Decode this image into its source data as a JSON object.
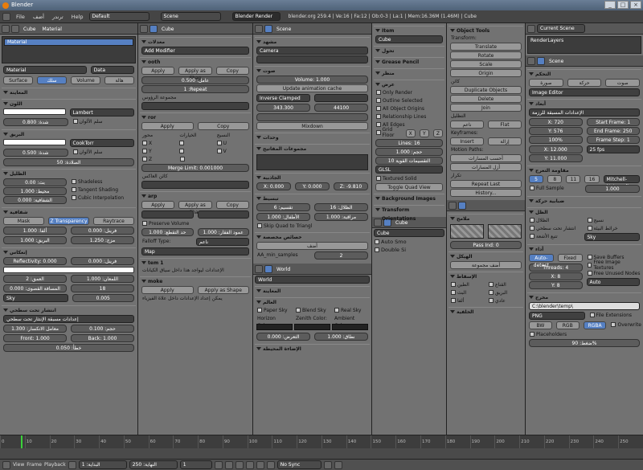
{
  "window": {
    "title": "Blender"
  },
  "menubar": {
    "items": [
      "File",
      "أضف",
      "ترندر",
      "Help"
    ],
    "layout": "Default",
    "scene": "Scene",
    "engine": "Blender Render",
    "stats": "blender.org 259.4 | Ve:16 | Fa:12 | Ob:0-3 | La:1 | Mem:16.36M (1.46M) | Cube"
  },
  "material": {
    "object": "Cube",
    "material_tab": "Material",
    "slot": "Material",
    "name": "Material",
    "data": "Data",
    "tabs": [
      "Surface",
      "سلك",
      "Volume",
      "هالة"
    ],
    "sections": [
      "المعاينة",
      "اللون",
      "البريق",
      "الظليل",
      "شفافية",
      "إنعكاس",
      "انتشار تحت سطحي"
    ],
    "diffuse_shader": "Lambert",
    "diffuse_int": "0.800 :شدة",
    "ramp": "سلم الألوان",
    "specular_shader": "CookTorr",
    "spec_int": "0.500 :شدة",
    "hardness": "50 :الصلادة",
    "emit": "0.00 :بث",
    "ambient": "1.000 :محيط",
    "translucency": "0.000 :الشفافية",
    "shadeless": "Shadeless",
    "tangent": "Tangent Shading",
    "cubic": "Cubic Interpolation",
    "trans_modes": [
      "Mask",
      "Z Transparency",
      "Raytrace"
    ],
    "alpha": "1.000 :ألفا",
    "fresnel": "0.000 :فرينل",
    "specular": "1.000 :البريق",
    "blend": "1.250 :مزج",
    "reflectivity": "Reflectivity: 0.000",
    "depth": "2 :العمق",
    "max_dist": "0.000 :المسافة القصوى",
    "fade": "Sky",
    "fresnel2": "0.000 :فرينل",
    "gloss": "1.000 :اللمعان",
    "amount": "0.000",
    "samples": "18",
    "threshold": "0.005",
    "aniso": "0.000",
    "sss_preset": "إعدادات مسبقة الإنتثار تحت سطحي",
    "sss_ior": "1.300 :معامل الانكسار",
    "sss_scale": "0.100 :حجم",
    "sss_front": "Front: 1.000",
    "sss_back": "Back: 1.000",
    "sss_error": "0.050 :خطأ"
  },
  "modifiers": {
    "object": "Cube",
    "add": "Add Modifier",
    "header": "معدلات",
    "smooth": {
      "name": "ooth",
      "buttons": [
        "Apply",
        "Apply as Shap",
        "Copy"
      ],
      "factor": "0.500 :عامل",
      "repeat": "1 :Repeat",
      "group": "مجموعة الرؤوس"
    },
    "mirror": {
      "name": "ror",
      "buttons": [
        "Apply",
        "Copy"
      ],
      "axis": "محور",
      "options": "الخيارات",
      "texture": "النسيج",
      "merge": "Merge Limit: 0.001000",
      "mirror_obj": "كائن العاكس"
    },
    "array": {
      "name": "arp",
      "buttons": [
        "Apply",
        "Apply as Shap",
        "Copy"
      ],
      "preserve": "Preserve Volume",
      "bind": "1.000 :حد التقطع",
      "pos": "1.000 :عمود الفقار",
      "falloff": "Falloff Type:",
      "falloff_val": "ناعم",
      "map": "Map"
    },
    "tempname": {
      "name": "tem 1",
      "hint": "الإعدادات ليواجد هذا داخل سياق الكيانات"
    },
    "smoke": {
      "name": "moke",
      "buttons": [
        "Apply",
        "Apply as Shape"
      ],
      "hint": "يمكن إعداد الإعدادات داخل علاة الفيزياء"
    }
  },
  "scene": {
    "title": "Scene",
    "camera": "Camera",
    "volume": "Volume: 1.000",
    "update": "Update animation cache",
    "inverse": "Inverse Clamped",
    "hr": "343.300",
    "lr": "44100",
    "mixdown": "Mixdown",
    "sections": [
      "مشهد",
      "صوت",
      "وحدات",
      "مجموعات المفاتيح",
      "الجاذبية",
      "تبسيط",
      "خصائص مخصصة"
    ],
    "gx": "X: 0.000",
    "gy": "Y: 0.000",
    "gz": "Z: -9.810",
    "subdiv": "6 :تقسيم",
    "child": "1.000 :الأطفال",
    "shadow": "16 :الظلال",
    "aa": "1.000 :مراقبة",
    "skip": "Skip Quad to Triangl",
    "add": "أضف",
    "aa_samples": "AA_min_samples",
    "aa_val": "2",
    "world_name": "World",
    "world_sections": [
      "المعاينة",
      "العالم"
    ],
    "paper": "Paper Sky",
    "blend": "Blend Sky",
    "real": "Real Sky",
    "horizon": "Horizon Color:",
    "zenith": "Zenith Color:",
    "ambient": "Ambient Color:",
    "exposure": "0.000 :التعرض",
    "range": "1.000 :نطاق",
    "env": "الإضاءة المحيطة"
  },
  "view3d": {
    "item": "Item",
    "cube": "Cube",
    "sections": [
      "تحول",
      "Grease Pencil",
      "منظر",
      "عرض"
    ],
    "only_render": "Only Render",
    "outline": "Outline Selected",
    "origins": "All Object Origins",
    "relationship": "Relationship Lines",
    "edges": "All Edges",
    "grid_floor": "Grid Floor",
    "lines": "Lines: 16",
    "scale": "1.000 :حجم",
    "subdiv": "10 التقسيمات القوية",
    "shading": "GLSL",
    "textured": "Textured Solid",
    "toggle_quad": "Toggle Quad View",
    "bg_images": "Background Images",
    "transform_orient": "Transform Orientations"
  },
  "tools": {
    "header": "Object Tools",
    "transform": "Transform:",
    "translate": "Translate",
    "rotate": "Rotate",
    "scale": "Scale",
    "origin": "Origin",
    "object": "كائن",
    "dup_objects": "Duplicate Objects",
    "delete": "Delete",
    "join": "Join",
    "shading": "التظليل",
    "smooth": "ناعم",
    "flat": "Flat",
    "keyframes": "Keyframes:",
    "insert": "Insert",
    "remove": "إزالة",
    "motion": "Motion Paths:",
    "calc": "أحسب المسارات",
    "clear": "أزل المسارات",
    "repeat": "تكرار",
    "repeat_last": "Repeat Last",
    "history": "History..."
  },
  "texture": {
    "sections": [
      "ملامح",
      "الهيكل",
      "الإسقاط",
      "الخلفية",
      "الألوان",
      "التدرج",
      "تأثير",
      "الألوان",
      "مرآة",
      "الوزن",
      "نموذج الشعاع"
    ],
    "pass": "Pass Ind: 0",
    "add_new": "أضف مجموعة",
    "clay": "الطين",
    "mask": "القناع",
    "emit": "البث",
    "spec": "البريق",
    "alpha": "ألفا",
    "normal": "عادي",
    "cube": "Cube"
  },
  "render": {
    "current_scene": "Current Scene",
    "renderlayers": "RenderLayers",
    "scene": "Scene",
    "tabs": [
      "صورة",
      "حركة",
      "صوت"
    ],
    "display": "Image Editor",
    "sections": [
      "التحكم",
      "أبعاد",
      "مقاومة التعرج",
      "ضبابية حركة",
      "الظل",
      "أداء",
      "الترقيع",
      "مكان",
      "تخطي",
      "معالجة بعدية",
      "طابع",
      "مخرج",
      "Bake"
    ],
    "preset": "الإعدادات المسبقة للرزمة",
    "res_x": "X: 720",
    "res_y": "Y: 576",
    "percent": "100%",
    "start": "Start Frame: 1",
    "end": "End Frame: 250",
    "step": "Frame Step: 1",
    "aspect_x": "X: 12.000",
    "aspect_y": "Y: 11.000",
    "fps": "25 fps",
    "aa_5": "5",
    "aa_8": "8",
    "aa_11": "11",
    "aa_16": "16",
    "filter": "Mitchell-Netravali",
    "filter_size": "1.000",
    "full_sample": "Full Sample",
    "shadows": "الظلال",
    "sss": "انتشار تحت سطحي",
    "env_map": "خرائط البيئة",
    "raytrace": "تتبع الأشعة",
    "textures": "نسيج",
    "sky": "Sky",
    "tiles_auto": "Auto-detect",
    "tiles_fixed": "Fixed",
    "threads": "Threads: 4",
    "tx": "X: 8",
    "ty": "Y: 8",
    "save_buffers": "Save Buffers",
    "free_image": "Free Image Textures",
    "free_unused": "Free Unused Nodes",
    "auto": "Auto",
    "output_path": "C:\\blender\\temp\\",
    "format": "PNG",
    "bw": "BW",
    "rgb": "RGB",
    "rgba": "RGBA",
    "file_ext": "File Extensions",
    "overwrite": "Overwrite",
    "placeholders": "Placeholders",
    "compression": "ضغط: 90%"
  },
  "timeline": {
    "ticks": [
      "0",
      "10",
      "20",
      "30",
      "40",
      "50",
      "60",
      "70",
      "80",
      "90",
      "100",
      "110",
      "120",
      "130",
      "140",
      "150",
      "160",
      "170",
      "180",
      "190",
      "200",
      "210",
      "220",
      "230",
      "240",
      "250"
    ],
    "view": "View",
    "frame": "Frame",
    "playback": "Playback",
    "start": "البداية: 1",
    "end": "النهاية: 250",
    "current": "1",
    "sync": "No Sync"
  }
}
